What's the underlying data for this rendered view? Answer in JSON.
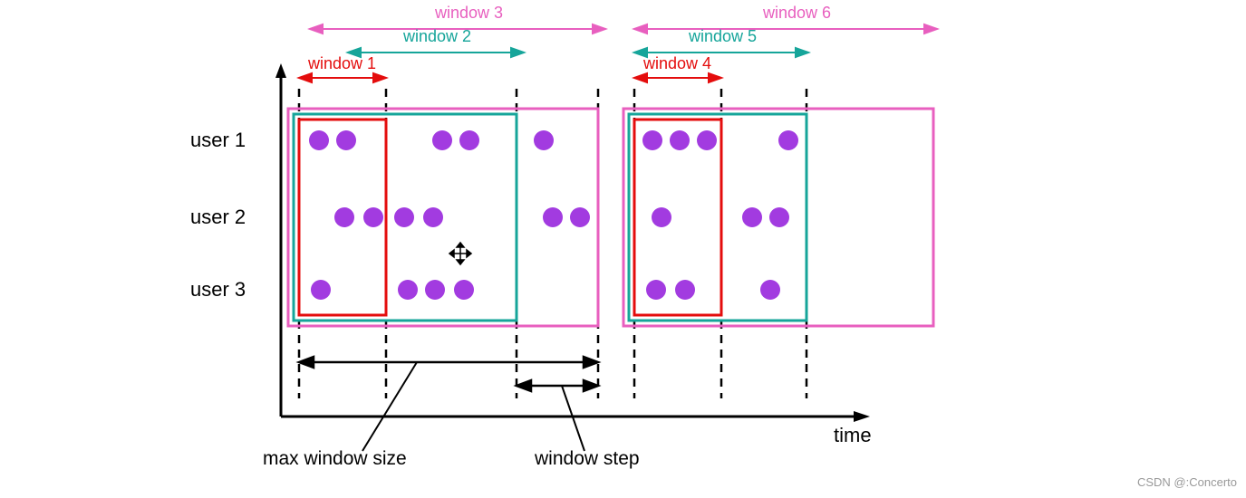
{
  "chart_data": {
    "type": "other",
    "title": "",
    "xlabel": "time",
    "ylabel": "",
    "users": [
      "user 1",
      "user 2",
      "user 3"
    ],
    "windows": [
      {
        "name": "window 1",
        "color": "#e40d0d"
      },
      {
        "name": "window 2",
        "color": "#16a59a"
      },
      {
        "name": "window 3",
        "color": "#e85fbf"
      },
      {
        "name": "window 4",
        "color": "#e40d0d"
      },
      {
        "name": "window 5",
        "color": "#16a59a"
      },
      {
        "name": "window 6",
        "color": "#e85fbf"
      }
    ],
    "annotations": [
      "max window size",
      "window step"
    ]
  },
  "labels": {
    "user1": "user 1",
    "user2": "user 2",
    "user3": "user 3",
    "window1": "window 1",
    "window2": "window 2",
    "window3": "window 3",
    "window4": "window 4",
    "window5": "window 5",
    "window6": "window 6",
    "time": "time",
    "max_window_size": "max window size",
    "window_step": "window step",
    "watermark": "CSDN @:Concerto"
  },
  "colors": {
    "red": "#e40d0d",
    "teal": "#16a59a",
    "magenta": "#e85fbf",
    "purple": "#a23be0",
    "black": "#000000"
  }
}
